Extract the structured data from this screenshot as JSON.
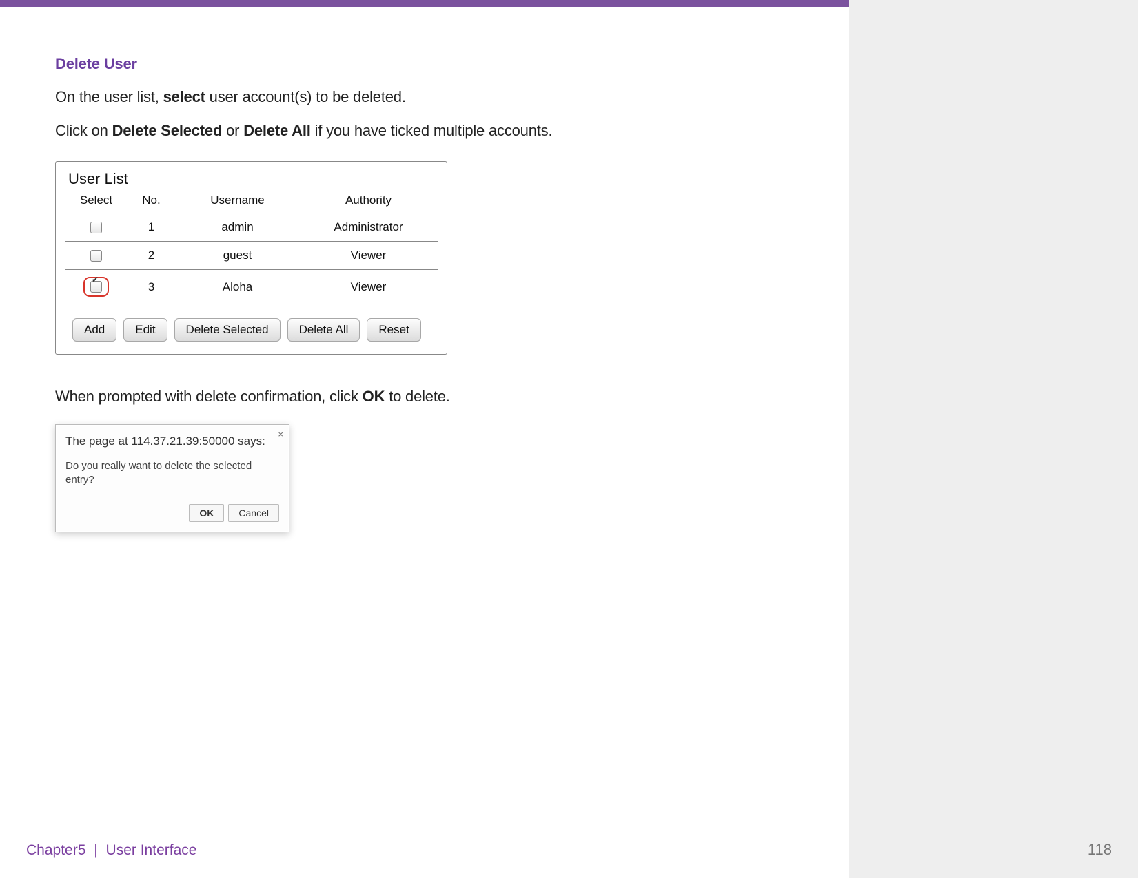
{
  "heading": "Delete User",
  "para1": {
    "pre": "On the user list, ",
    "bold1": "select",
    "post1": "  user account(s) to be deleted."
  },
  "para2": {
    "pre": "Click on ",
    "bold1": "Delete Selected",
    "mid": " or ",
    "bold2": "Delete All",
    "post": " if you have ticked multiple accounts."
  },
  "userlist": {
    "panel_title": "User List",
    "columns": {
      "select": "Select",
      "no": "No.",
      "username": "Username",
      "authority": "Authority"
    },
    "rows": [
      {
        "no": "1",
        "username": "admin",
        "authority": "Administrator",
        "checked": false,
        "highlighted": false
      },
      {
        "no": "2",
        "username": "guest",
        "authority": "Viewer",
        "checked": false,
        "highlighted": false
      },
      {
        "no": "3",
        "username": "Aloha",
        "authority": "Viewer",
        "checked": true,
        "highlighted": true
      }
    ],
    "buttons": {
      "add": "Add",
      "edit": "Edit",
      "delete_selected": "Delete Selected",
      "delete_all": "Delete All",
      "reset": "Reset"
    }
  },
  "para3": {
    "pre": "When prompted with delete confirmation, click ",
    "bold1": "OK",
    "post": " to delete."
  },
  "dialog": {
    "close": "×",
    "title": "The page at 114.37.21.39:50000 says:",
    "message": "Do you really want to delete the selected entry?",
    "ok": "OK",
    "cancel": "Cancel"
  },
  "footer": {
    "chapter": "Chapter5",
    "separator": "|",
    "section": "User Interface",
    "page": "118"
  }
}
